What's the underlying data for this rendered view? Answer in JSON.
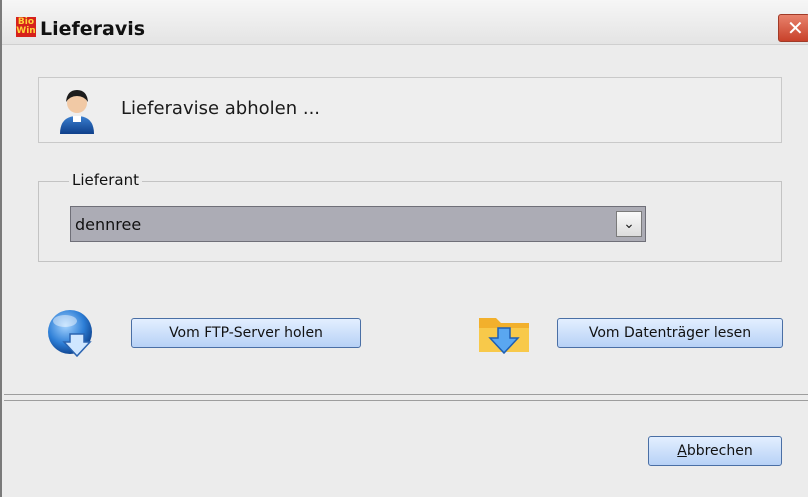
{
  "window": {
    "title": "Lieferavis",
    "app_icon_text": [
      "Bio",
      "Win"
    ],
    "close_glyph": "✕"
  },
  "header": {
    "icon": "user-icon",
    "text": "Lieferavise abholen ..."
  },
  "supplier_group": {
    "legend": "Lieferant",
    "selected": "dennree",
    "dropdown_glyph": "⌄"
  },
  "actions": {
    "ftp_icon": "ftp-download-icon",
    "ftp_button": "Vom FTP-Server holen",
    "media_icon": "folder-download-icon",
    "media_button": "Vom Datenträger lesen"
  },
  "footer": {
    "cancel_button": "Abbrechen"
  }
}
